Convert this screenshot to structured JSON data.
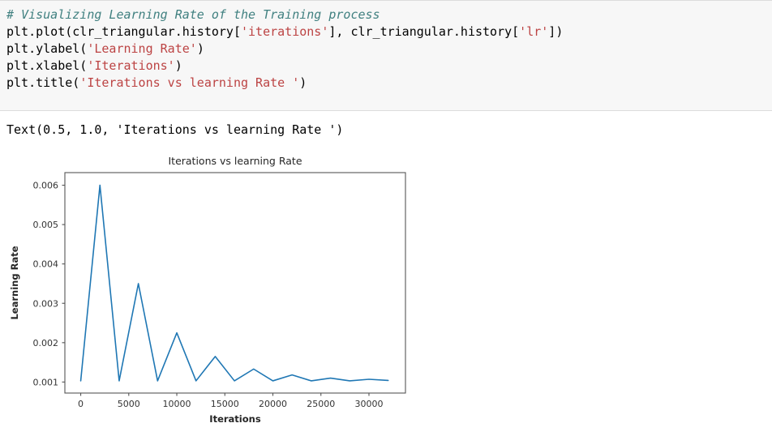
{
  "notebook": {
    "code_cell": {
      "lines": [
        [
          {
            "t": "comment",
            "s": "# Visualizing Learning Rate of the Training process"
          }
        ],
        [
          {
            "t": "plain",
            "s": "plt.plot(clr_triangular.history["
          },
          {
            "t": "string",
            "s": "'iterations'"
          },
          {
            "t": "plain",
            "s": "], clr_triangular.history["
          },
          {
            "t": "string",
            "s": "'lr'"
          },
          {
            "t": "plain",
            "s": "])"
          }
        ],
        [
          {
            "t": "plain",
            "s": "plt.ylabel("
          },
          {
            "t": "string",
            "s": "'Learning Rate'"
          },
          {
            "t": "plain",
            "s": ")"
          }
        ],
        [
          {
            "t": "plain",
            "s": "plt.xlabel("
          },
          {
            "t": "string",
            "s": "'Iterations'"
          },
          {
            "t": "plain",
            "s": ")"
          }
        ],
        [
          {
            "t": "plain",
            "s": "plt.title("
          },
          {
            "t": "string",
            "s": "'Iterations vs learning Rate '"
          },
          {
            "t": "plain",
            "s": ")"
          }
        ]
      ]
    },
    "output_text": "Text(0.5, 1.0, 'Iterations vs learning Rate ')"
  },
  "chart_data": {
    "type": "line",
    "title": "Iterations vs learning Rate",
    "xlabel": "Iterations",
    "ylabel": "Learning Rate",
    "xlim": [
      -1650,
      33800
    ],
    "ylim": [
      0.00072,
      0.00632
    ],
    "grid": false,
    "legend": null,
    "xticks": [
      0,
      5000,
      10000,
      15000,
      20000,
      25000,
      30000
    ],
    "xticklabels": [
      "0",
      "5000",
      "10000",
      "15000",
      "20000",
      "25000",
      "30000"
    ],
    "yticks": [
      0.001,
      0.002,
      0.003,
      0.004,
      0.005,
      0.006
    ],
    "yticklabels": [
      "0.001",
      "0.002",
      "0.003",
      "0.004",
      "0.005",
      "0.006"
    ],
    "line_color": "#1f77b4",
    "series": [
      {
        "name": "lr",
        "x": [
          0,
          2000,
          4000,
          6000,
          8000,
          10000,
          12000,
          14000,
          16000,
          18000,
          20000,
          22000,
          24000,
          26000,
          28000,
          30000,
          32000
        ],
        "y": [
          0.00103,
          0.006,
          0.00103,
          0.0035,
          0.00103,
          0.00225,
          0.00103,
          0.00165,
          0.00103,
          0.00133,
          0.00103,
          0.00118,
          0.00103,
          0.0011,
          0.00103,
          0.00107,
          0.00104
        ]
      }
    ]
  }
}
